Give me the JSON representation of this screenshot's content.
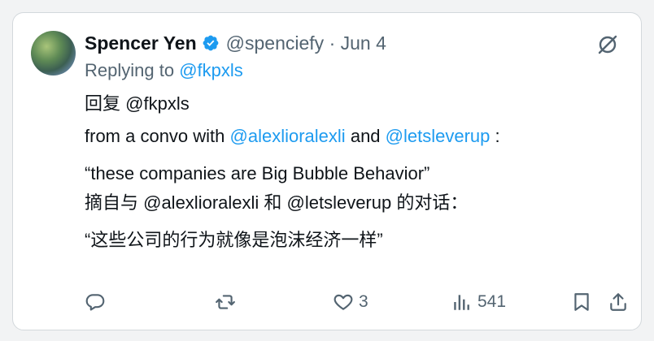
{
  "tweet": {
    "author_name": "Spencer Yen",
    "handle": "@spenciefy",
    "separator": "·",
    "date": "Jun 4",
    "replying_prefix": "Replying to",
    "replying_to": "@fkpxls",
    "body": {
      "zh_reply_prefix": "回复",
      "zh_reply_handle": "@fkpxls",
      "convo_prefix": "from a convo with",
      "mention_1": "@alexlioralexli",
      "and_word": "and",
      "mention_2": "@letsleverup",
      "colon": ":",
      "quote_en": "“these companies are Big Bubble Behavior”",
      "zh_convo": "摘自与 @alexlioralexli 和 @letsleverup 的对话：",
      "quote_zh": "“这些公司的行为就像是泡沫经济一样”"
    },
    "actions": {
      "likes": "3",
      "views": "541"
    }
  },
  "icons": {
    "verified": "verified-badge-icon",
    "more": "grok-icon",
    "reply": "reply-icon",
    "retweet": "retweet-icon",
    "like": "heart-icon",
    "views": "views-icon",
    "bookmark": "bookmark-icon",
    "share": "share-icon"
  },
  "colors": {
    "link": "#1d9bf0",
    "muted": "#536471",
    "text": "#0f1419"
  }
}
